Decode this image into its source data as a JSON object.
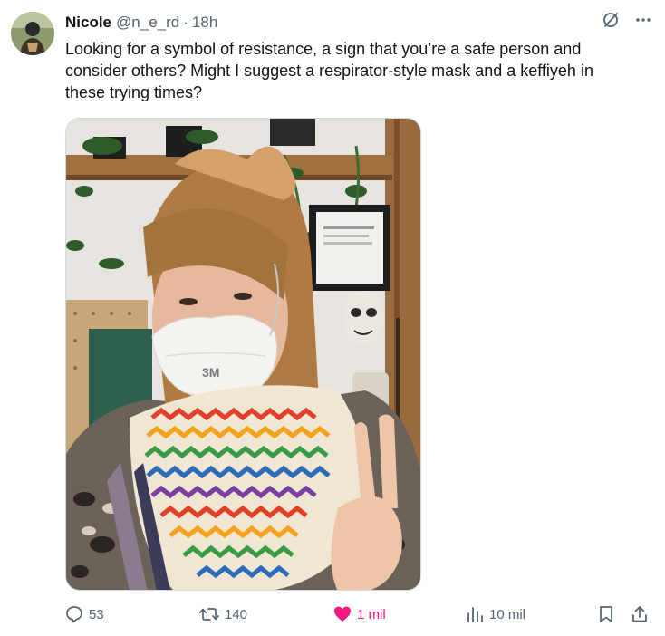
{
  "post": {
    "author_name": "Nicole",
    "handle": "@n_e_rd",
    "separator": "·",
    "time": "18h",
    "text": "Looking for a symbol of resistance, a sign that you’re a safe person and consider others? Might I suggest a respirator-style mask and a keffiyeh in these trying times?",
    "media_mask_brand": "3M"
  },
  "actions": {
    "replies": "53",
    "reposts": "140",
    "likes": "1 mil",
    "views": "10 mil"
  },
  "colors": {
    "like": "#f91880",
    "muted": "#536471",
    "text": "#0f1419"
  },
  "icons": {
    "reply": "reply-icon",
    "repost": "repost-icon",
    "like": "heart-icon",
    "views": "views-icon",
    "bookmark": "bookmark-icon",
    "share": "share-icon",
    "grok": "grok-icon",
    "more": "more-icon"
  }
}
